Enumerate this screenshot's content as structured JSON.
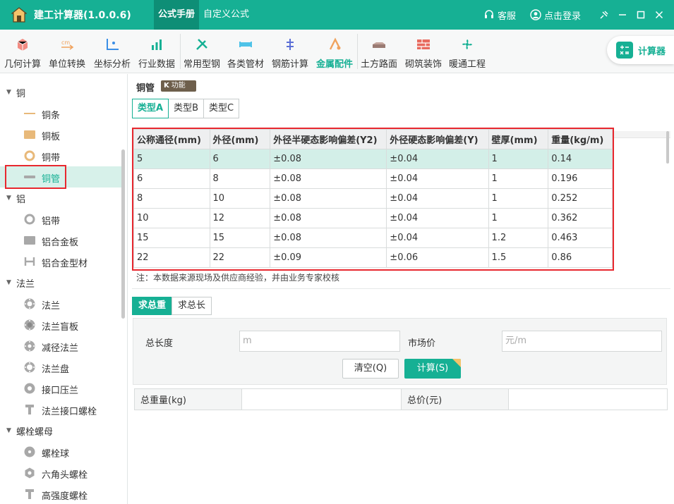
{
  "app": {
    "title": "建工计算器(1.0.0.6)",
    "tabs": [
      {
        "label": "公式手册",
        "active": true
      },
      {
        "label": "自定义公式",
        "active": false
      }
    ],
    "service_label": "客服",
    "login_label": "点击登录"
  },
  "toolbar": {
    "items": [
      {
        "label": "几何计算",
        "icon": "cube-icon"
      },
      {
        "label": "单位转换",
        "icon": "unit-convert-icon"
      },
      {
        "label": "坐标分析",
        "icon": "coordinate-icon"
      },
      {
        "label": "行业数据",
        "icon": "bar-chart-icon"
      },
      {
        "label": "常用型钢",
        "icon": "tools-icon"
      },
      {
        "label": "各类管材",
        "icon": "pipe-icon"
      },
      {
        "label": "钢筋计算",
        "icon": "rebar-icon"
      },
      {
        "label": "金属配件",
        "icon": "metal-parts-icon",
        "active": true
      },
      {
        "label": "土方路面",
        "icon": "road-icon"
      },
      {
        "label": "砌筑装饰",
        "icon": "brick-icon"
      },
      {
        "label": "暖通工程",
        "icon": "fan-icon"
      }
    ],
    "calculator_label": "计算器"
  },
  "sidebar": {
    "groups": [
      {
        "label": "铜",
        "items": [
          "铜条",
          "铜板",
          "铜带",
          "铜管"
        ]
      },
      {
        "label": "铝",
        "items": [
          "铝带",
          "铝合金板",
          "铝合金型材"
        ]
      },
      {
        "label": "法兰",
        "items": [
          "法兰",
          "法兰盲板",
          "减径法兰",
          "法兰盘",
          "接口压兰",
          "法兰接口螺栓"
        ]
      },
      {
        "label": "螺栓螺母",
        "items": [
          "螺栓球",
          "六角头螺栓",
          "高强度螺栓"
        ]
      }
    ],
    "selected": "铜管"
  },
  "content": {
    "title": "铜管",
    "badge": "功能",
    "type_tabs": [
      "类型A",
      "类型B",
      "类型C"
    ],
    "table": {
      "headers": [
        "公称通径(mm)",
        "外径(mm)",
        "外径半硬态影响偏差(Y2)",
        "外径硬态影响偏差(Y)",
        "壁厚(mm)",
        "重量(kg/m)"
      ],
      "rows": [
        [
          "5",
          "6",
          "±0.08",
          "±0.04",
          "1",
          "0.14"
        ],
        [
          "6",
          "8",
          "±0.08",
          "±0.04",
          "1",
          "0.196"
        ],
        [
          "8",
          "10",
          "±0.08",
          "±0.04",
          "1",
          "0.252"
        ],
        [
          "10",
          "12",
          "±0.08",
          "±0.04",
          "1",
          "0.362"
        ],
        [
          "15",
          "15",
          "±0.08",
          "±0.04",
          "1.2",
          "0.463"
        ],
        [
          "22",
          "22",
          "±0.09",
          "±0.06",
          "1.5",
          "0.86"
        ]
      ]
    },
    "note": "注：本数据来源现场及供应商经验，并由业务专家校核",
    "calc_tabs": [
      "求总重",
      "求总长"
    ],
    "form": {
      "length_label": "总长度",
      "length_placeholder": "m",
      "price_label": "市场价",
      "price_placeholder": "元/m",
      "clear_label": "清空(Q)",
      "calc_label": "计算(S)"
    },
    "results": {
      "weight_label": "总重量(kg)",
      "weight_value": "",
      "price_label": "总价(元)",
      "price_value": ""
    }
  }
}
